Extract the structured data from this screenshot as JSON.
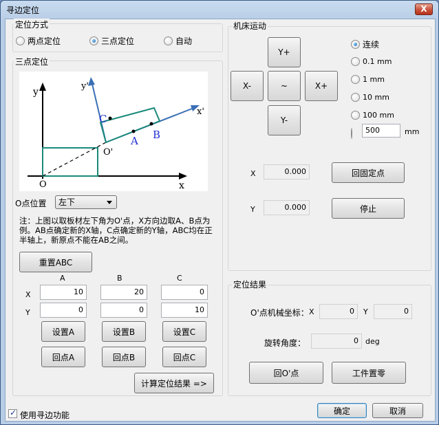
{
  "window": {
    "title": "寻边定位",
    "close_label": "X"
  },
  "mode_group": {
    "title": "定位方式",
    "options": [
      {
        "label": "两点定位",
        "selected": false
      },
      {
        "label": "三点定位",
        "selected": true
      },
      {
        "label": "自动",
        "selected": false
      }
    ]
  },
  "three_point": {
    "title": "三点定位",
    "diagram": {
      "y_axis": "y",
      "x_axis": "x",
      "origin": "O",
      "y_prime": "y'",
      "x_prime": "x'",
      "o_prime": "O'",
      "A": "A",
      "B": "B",
      "C": "C"
    },
    "origin_position_label": "O点位置",
    "origin_position_value": "左下",
    "note": "注：上图以取板材左下角为O'点，X方向边取A、B点为例。AB点确定新的X轴，C点确定新的Y轴，ABC均在正半轴上，新原点不能在AB之间。",
    "reset_label": "重置ABC",
    "col_A": "A",
    "col_B": "B",
    "col_C": "C",
    "row_x": "X",
    "row_y": "Y",
    "A": {
      "x": "10",
      "y": "0"
    },
    "B": {
      "x": "20",
      "y": "0"
    },
    "C": {
      "x": "0",
      "y": "10"
    },
    "set_A": "设置A",
    "set_B": "设置B",
    "set_C": "设置C",
    "goto_A": "回点A",
    "goto_B": "回点B",
    "goto_C": "回点C",
    "compute_label": "计算定位结果 =>"
  },
  "machine": {
    "title": "机床运动",
    "y_plus": "Y+",
    "y_minus": "Y-",
    "x_plus": "X+",
    "x_minus": "X-",
    "center": "~",
    "steps": [
      {
        "label": "连续",
        "selected": true
      },
      {
        "label": "0.1 mm",
        "selected": false
      },
      {
        "label": "1 mm",
        "selected": false
      },
      {
        "label": "10 mm",
        "selected": false
      },
      {
        "label": "100 mm",
        "selected": false
      }
    ],
    "custom_value": "500",
    "custom_unit": "mm",
    "x_label": "X",
    "x_value": "0.000",
    "y_label": "Y",
    "y_value": "0.000",
    "home_label": "回固定点",
    "stop_label": "停止"
  },
  "result": {
    "title": "定位结果",
    "coord_label": "O'点机械坐标：",
    "x_label": "X",
    "x_value": "0",
    "y_label": "Y",
    "y_value": "0",
    "angle_label": "旋转角度：",
    "angle_value": "0",
    "angle_unit": "deg",
    "goto_o_label": "回O'点",
    "zero_label": "工件置零"
  },
  "footer": {
    "use_edge_label": "使用寻边功能",
    "use_edge_checked": true,
    "ok_label": "确定",
    "cancel_label": "取消"
  },
  "colors": {
    "axis_blue": "#3a6fb5",
    "board_teal": "#1b8a7a",
    "label_blue": "#1f2fd0"
  }
}
